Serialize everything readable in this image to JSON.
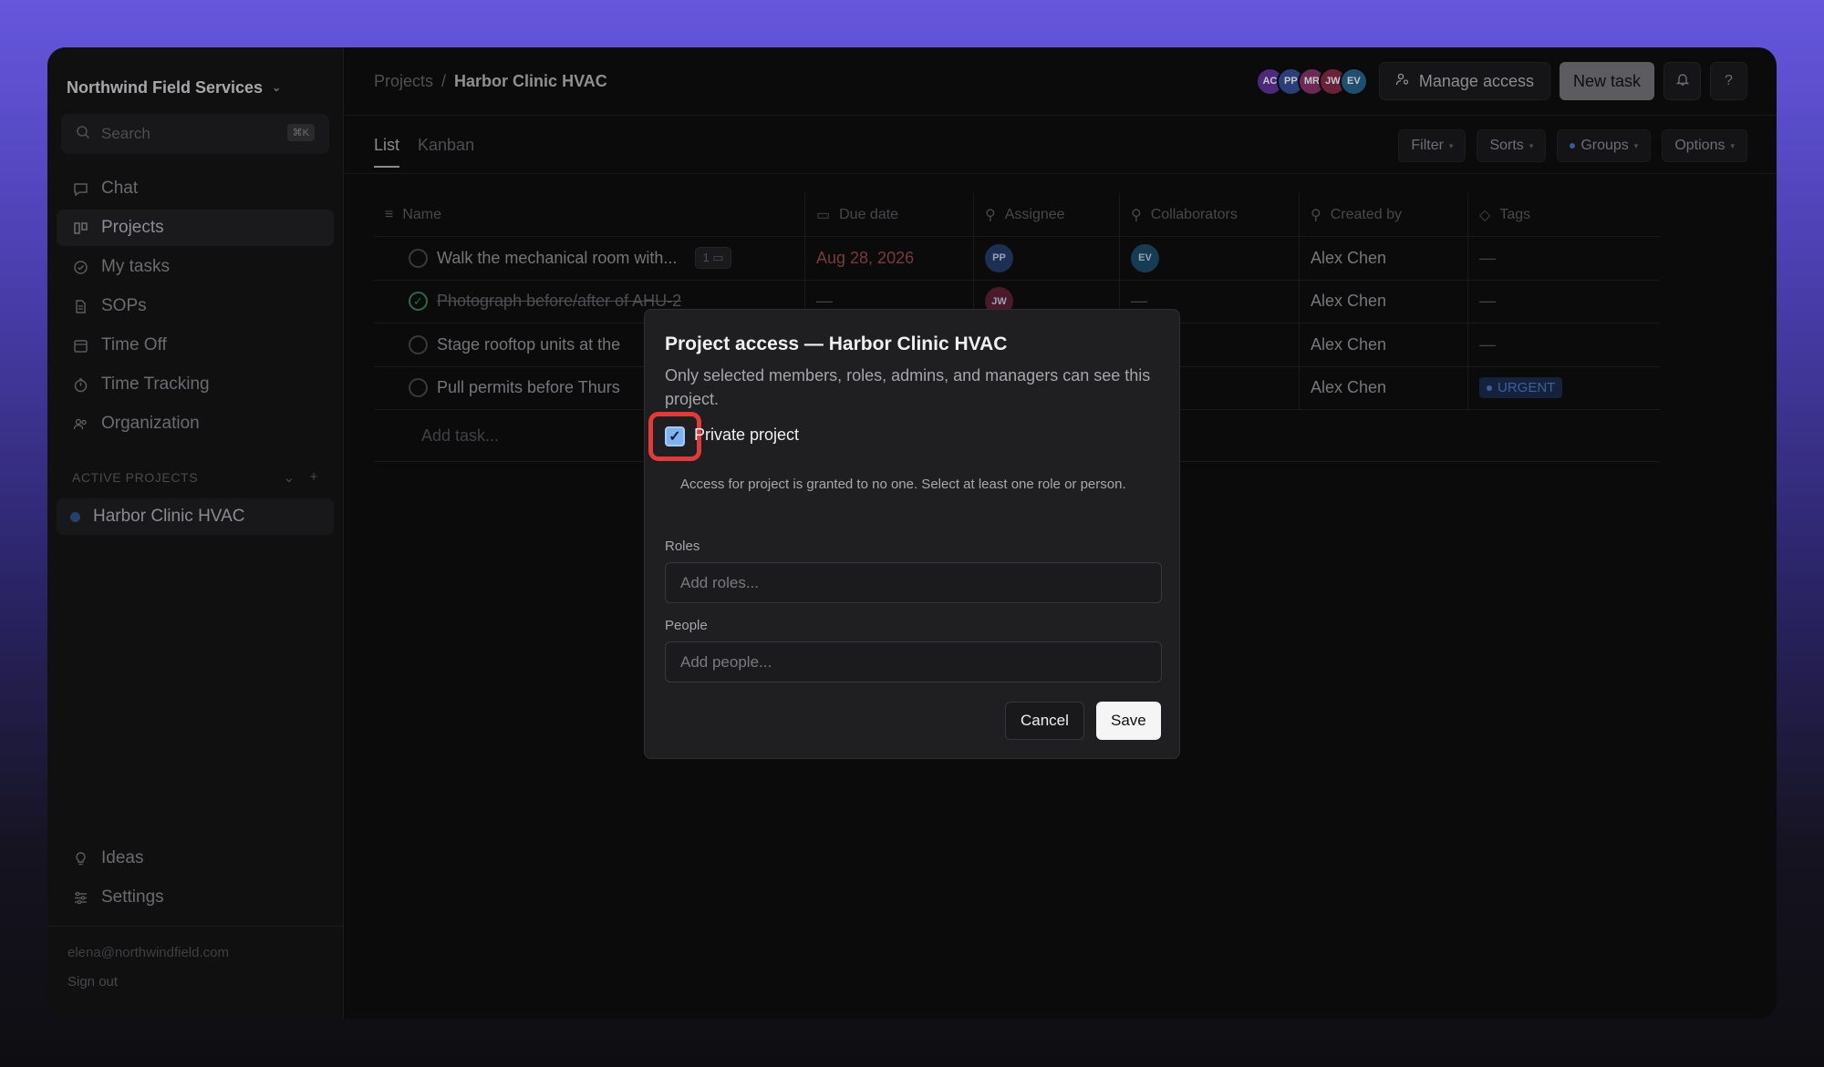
{
  "sidebar": {
    "workspace": "Northwind Field Services",
    "search_placeholder": "Search",
    "search_shortcut": "⌘K",
    "nav": [
      {
        "label": "Chat",
        "icon": "chat-icon"
      },
      {
        "label": "Projects",
        "icon": "projects-icon"
      },
      {
        "label": "My tasks",
        "icon": "check-circle-icon"
      },
      {
        "label": "SOPs",
        "icon": "document-icon"
      },
      {
        "label": "Time Off",
        "icon": "calendar-icon"
      },
      {
        "label": "Time Tracking",
        "icon": "timer-icon"
      },
      {
        "label": "Organization",
        "icon": "people-icon"
      }
    ],
    "active_projects_heading": "ACTIVE PROJECTS",
    "project": "Harbor Clinic HVAC",
    "bottom_nav": [
      {
        "label": "Ideas",
        "icon": "lightbulb-icon"
      },
      {
        "label": "Settings",
        "icon": "sliders-icon"
      }
    ],
    "user_email": "elena@northwindfield.com",
    "sign_out": "Sign out"
  },
  "header": {
    "breadcrumb_root": "Projects",
    "breadcrumb_sep": "/",
    "breadcrumb_current": "Harbor Clinic HVAC",
    "avatars": [
      {
        "initials": "AC",
        "color": "#4b2a7a"
      },
      {
        "initials": "PP",
        "color": "#2a3f7a"
      },
      {
        "initials": "MR",
        "color": "#6a2a55"
      },
      {
        "initials": "JW",
        "color": "#6a2238"
      },
      {
        "initials": "EV",
        "color": "#1f4f6e"
      }
    ],
    "manage_access": "Manage access",
    "new_task": "New task",
    "help": "?"
  },
  "tabs": {
    "list": "List",
    "kanban": "Kanban"
  },
  "toolbar": {
    "filter": "Filter",
    "sorts": "Sorts",
    "groups": "Groups",
    "options": "Options"
  },
  "table": {
    "columns": [
      "Name",
      "Due date",
      "Assignee",
      "Collaborators",
      "Created by",
      "Tags"
    ],
    "rows": [
      {
        "name": "Walk the mechanical room with...",
        "comments": "1",
        "due": "Aug 28, 2026",
        "assignee": "PP",
        "collaborator": "EV",
        "created_by": "Alex Chen",
        "tags": "—"
      },
      {
        "name": "Photograph before/after of AHU-2",
        "due": "—",
        "assignee": "JW",
        "collaborator": "—",
        "created_by": "Alex Chen",
        "tags": "—"
      },
      {
        "name": "Stage rooftop units at the",
        "created_by": "Alex Chen",
        "tags": "—"
      },
      {
        "name": "Pull permits before Thurs",
        "created_by": "Alex Chen",
        "tags": "URGENT"
      }
    ],
    "add_task": "Add task..."
  },
  "modal": {
    "title": "Project access — Harbor Clinic HVAC",
    "description": "Only selected members, roles, admins, and managers can see this project.",
    "private_label": "Private project",
    "private_checked": true,
    "note": "Access for project is granted to no one. Select at least one role or person.",
    "roles_label": "Roles",
    "roles_placeholder": "Add roles...",
    "people_label": "People",
    "people_placeholder": "Add people...",
    "cancel": "Cancel",
    "save": "Save"
  }
}
